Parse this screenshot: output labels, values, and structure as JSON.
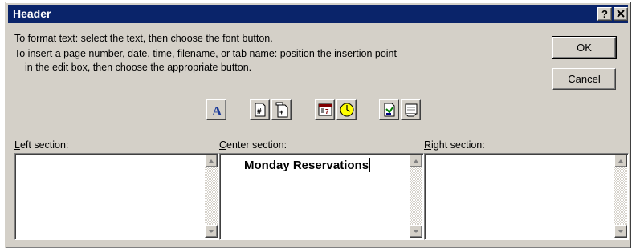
{
  "dialog": {
    "title": "Header",
    "help_button": "?",
    "close_button": "✕"
  },
  "instructions": {
    "line1": "To format text:  select the text, then choose the font button.",
    "line2": "To insert a page number, date, time, filename, or tab name:  position the insertion point",
    "line3": "in the edit box, then choose the appropriate button."
  },
  "buttons": {
    "ok_label": "OK",
    "cancel_label": "Cancel"
  },
  "toolbar": {
    "items": [
      "font-icon",
      "page-number-icon",
      "total-pages-icon",
      "date-icon",
      "time-icon",
      "filename-icon",
      "sheet-name-icon"
    ]
  },
  "sections": {
    "left": {
      "label_prefix": "",
      "label_accel": "L",
      "label_rest": "eft section:",
      "value": ""
    },
    "center": {
      "label_prefix": "",
      "label_accel": "C",
      "label_rest": "enter section:",
      "value": "Monday Reservations"
    },
    "right": {
      "label_prefix": "",
      "label_accel": "R",
      "label_rest": "ight section:",
      "value": ""
    }
  }
}
